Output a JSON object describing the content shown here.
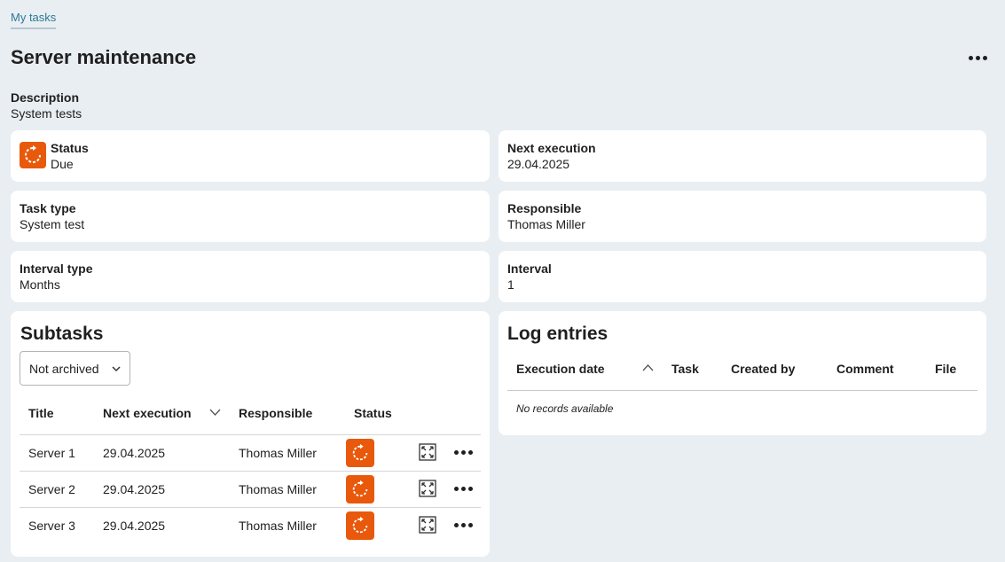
{
  "breadcrumb": {
    "label": "My tasks"
  },
  "page": {
    "title": "Server maintenance"
  },
  "description": {
    "label": "Description",
    "value": "System tests"
  },
  "fields": {
    "status": {
      "label": "Status",
      "value": "Due",
      "icon": "refresh-due-icon",
      "color": "#e8590c"
    },
    "next_execution": {
      "label": "Next execution",
      "value": "29.04.2025"
    },
    "task_type": {
      "label": "Task type",
      "value": "System test"
    },
    "responsible": {
      "label": "Responsible",
      "value": "Thomas Miller"
    },
    "interval_type": {
      "label": "Interval type",
      "value": "Months"
    },
    "interval": {
      "label": "Interval",
      "value": "1"
    }
  },
  "subtasks": {
    "title": "Subtasks",
    "filter": {
      "selected": "Not archived"
    },
    "columns": [
      "Title",
      "Next execution",
      "Responsible",
      "Status"
    ],
    "rows": [
      {
        "title": "Server 1",
        "next_execution": "29.04.2025",
        "responsible": "Thomas Miller"
      },
      {
        "title": "Server 2",
        "next_execution": "29.04.2025",
        "responsible": "Thomas Miller"
      },
      {
        "title": "Server 3",
        "next_execution": "29.04.2025",
        "responsible": "Thomas Miller"
      }
    ]
  },
  "log_entries": {
    "title": "Log entries",
    "columns": [
      "Execution date",
      "Task",
      "Created by",
      "Comment",
      "File"
    ],
    "empty_text": "No records available"
  },
  "icons": {
    "accent": "#e8590c",
    "link": "#2c7a94"
  }
}
